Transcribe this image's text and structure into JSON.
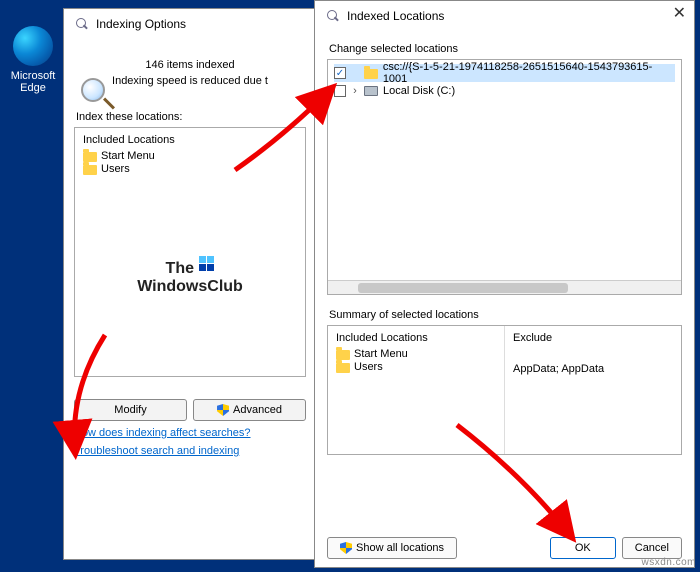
{
  "desktop": {
    "edge_label": "Microsoft\nEdge"
  },
  "win1": {
    "title": "Indexing Options",
    "status": "146 items indexed",
    "speed": "Indexing speed is reduced due t",
    "locations_label": "Index these locations:",
    "included_header": "Included Locations",
    "items": [
      "Start Menu",
      "Users"
    ],
    "brand_line1": "The",
    "brand_line2": "WindowsClub",
    "modify_btn": "Modify",
    "advanced_btn": "Advanced",
    "link1": "How does indexing affect searches?",
    "link2": "Troubleshoot search and indexing"
  },
  "win2": {
    "title": "Indexed Locations",
    "change_label": "Change selected locations",
    "tree": [
      {
        "checked": true,
        "icon": "folder",
        "label": "csc://{S-1-5-21-1974118258-2651515640-1543793615-1001",
        "selected": true,
        "expand": ""
      },
      {
        "checked": false,
        "icon": "hdd",
        "label": "Local Disk (C:)",
        "selected": false,
        "expand": "›"
      }
    ],
    "summary_label": "Summary of selected locations",
    "sum_included_hdr": "Included Locations",
    "sum_exclude_hdr": "Exclude",
    "sum_included": [
      "Start Menu",
      "Users"
    ],
    "sum_exclude": [
      "",
      "AppData; AppData"
    ],
    "showall_btn": "Show all locations",
    "ok_btn": "OK",
    "cancel_btn": "Cancel"
  },
  "watermark": "wsxdn.com"
}
